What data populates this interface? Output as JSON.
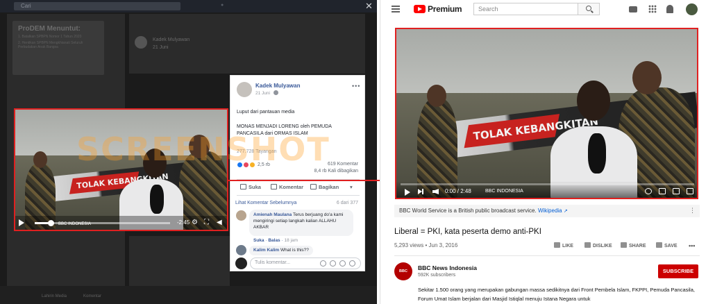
{
  "facebook": {
    "search_placeholder": "Cari",
    "close_glyph": "✕",
    "background": {
      "poster_title": "ProDEM Menuntut:",
      "poster_line1": "1. Batalkan SPBPN Nomor 1 Tahun 2020",
      "poster_line2": "2. Hentikan SPBPN Mengkhianati Seluruh Perbudakan Anak Bangsa",
      "author": "Kadek Mulyawan",
      "time": "21 Juni",
      "bottom_items": [
        "Lahirin Media",
        "Komentar"
      ]
    },
    "video": {
      "banner_text": "TOLAK KEBANGKITAN",
      "channel_tag": "BBC INDONESIA",
      "time_remaining": "-2:45",
      "progress": 0.12
    },
    "post": {
      "author": "Kadek Mulyawan",
      "date": "21 Juni",
      "more": "•••",
      "line1": "Luput dari pantauan media",
      "line2": "MONAS MENJADI LORENG oleh PEMUDA PANCASILA dari ORMAS ISLAM",
      "views": "277.728 Tayangan",
      "reactions": "2,5 rb",
      "comments": "619 Komentar",
      "shares": "8,4 rb Kali dibagikan",
      "actions": {
        "like": "Suka",
        "comment": "Komentar",
        "share": "Bagikan"
      },
      "previous_comments": "Lihat Komentar Sebelumnya",
      "comment_count": "6 dari 377",
      "comment1": {
        "author": "Amienah Maulana",
        "text": "Terus berjuang do'a kami mengiringi setiap langkah kalian ALLAHU AKBAR",
        "like": "Suka",
        "reply": "Balas",
        "time": "18 jam"
      },
      "comment2": {
        "author": "Kalim Kalim",
        "text": "What is this??"
      },
      "compose_placeholder": "Tulis komentar..."
    },
    "watermark": "SCREENSHOT"
  },
  "youtube": {
    "brand": "Premium",
    "search_placeholder": "Search",
    "video": {
      "banner_text": "TOLAK KEBANGKITAN",
      "channel_tag": "BBC INDONESIA",
      "time": "0:00 / 2:48",
      "progress": 0.0
    },
    "info_text": "BBC World Service is a British public broadcast service.",
    "info_link": "Wikipedia",
    "title": "Liberal = PKI, kata peserta demo anti-PKI",
    "views_date": "5,293 views • Jun 3, 2016",
    "actions": {
      "like": "LIKE",
      "dislike": "DISLIKE",
      "share": "SHARE",
      "save": "SAVE"
    },
    "channel_avatar": "BBC NEWS",
    "channel_name": "BBC News Indonesia",
    "subscribers": "592K subscribers",
    "subscribe": "SUBSCRIBE",
    "description": "Sekitar 1.500 orang yang merupakan gabungan massa sedikitnya dari Front Pembela Islam, FKPPI, Pemuda Pancasila, Forum Umat Islam berjalan dari Masjid Istiqlal menuju Istana Negara untuk"
  }
}
